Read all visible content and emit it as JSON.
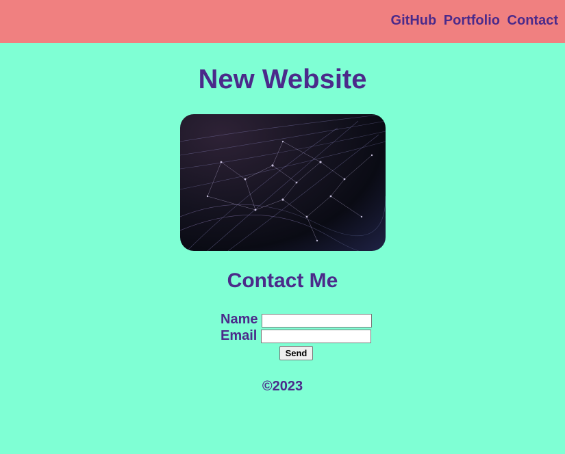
{
  "nav": {
    "links": [
      "GitHub",
      "Portfolio",
      "Contact"
    ]
  },
  "header": {
    "title": "New Website"
  },
  "hero": {
    "image_alt": "network-lines-image"
  },
  "contact": {
    "heading": "Contact Me",
    "name_label": "Name",
    "name_value": "",
    "email_label": "Email",
    "email_value": "",
    "send_label": "Send"
  },
  "footer": {
    "text": "©2023"
  },
  "colors": {
    "background": "#7fffd4",
    "topbar": "#f08080",
    "text": "#4b2a8a"
  }
}
